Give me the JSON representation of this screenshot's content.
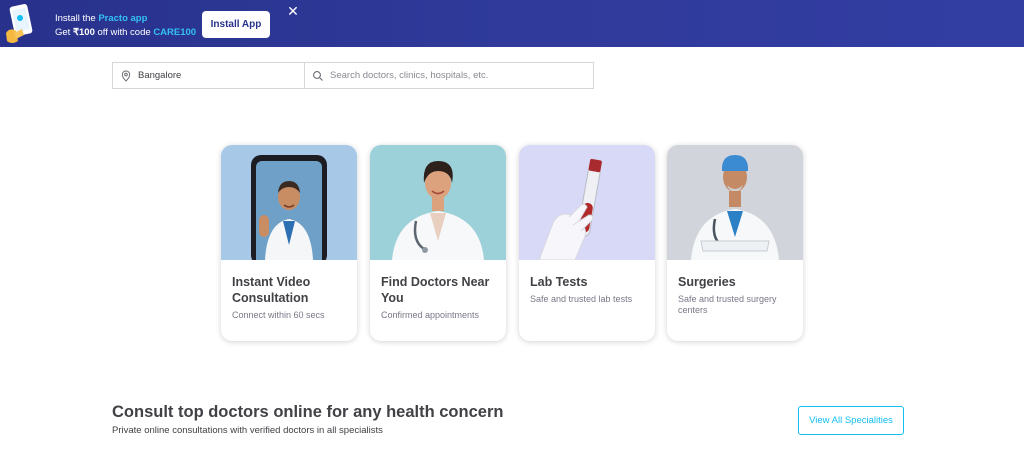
{
  "banner": {
    "line1_prefix": "Install the ",
    "line1_app": "Practo app",
    "line2_prefix": "Get ",
    "line2_amount": "₹100",
    "line2_mid": " off with code ",
    "line2_code": "CARE100",
    "install_label": "Install App",
    "close_glyph": "✕"
  },
  "search": {
    "location_value": "Bangalore",
    "query_placeholder": "Search doctors, clinics, hospitals, etc."
  },
  "cards": [
    {
      "title": "Instant Video Consultation",
      "subtitle": "Connect within 60 secs",
      "bg": "#a8c8e8"
    },
    {
      "title": "Find Doctors Near You",
      "subtitle": "Confirmed appointments",
      "bg": "#9dd1da"
    },
    {
      "title": "Lab Tests",
      "subtitle": "Safe and trusted lab tests",
      "bg": "#d8d9f7"
    },
    {
      "title": "Surgeries",
      "subtitle": "Safe and trusted surgery centers",
      "bg": "#d1d4db"
    }
  ],
  "section": {
    "title": "Consult top doctors online for any health concern",
    "subtitle": "Private online consultations with verified doctors in all specialists",
    "view_all_label": "View All Specialities"
  },
  "colors": {
    "banner_bg": "#28328c",
    "accent": "#14bef0",
    "text": "#414146"
  }
}
